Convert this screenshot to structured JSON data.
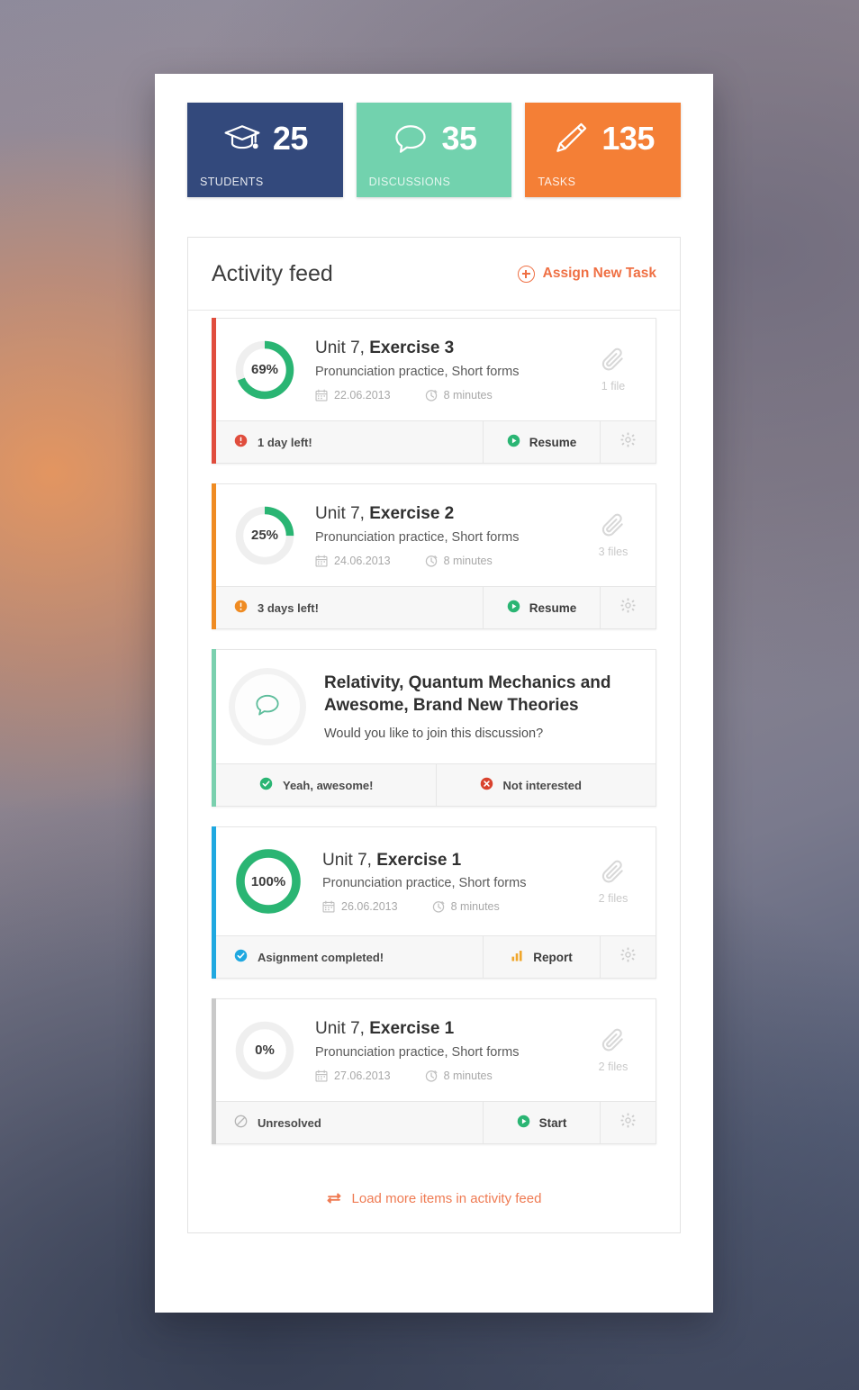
{
  "stats": [
    {
      "icon": "graduation-cap-icon",
      "value": "25",
      "label": "STUDENTS",
      "color": "#33497c"
    },
    {
      "icon": "speech-bubble-icon",
      "value": "35",
      "label": "DISCUSSIONS",
      "color": "#72d2ae"
    },
    {
      "icon": "pencil-icon",
      "value": "135",
      "label": "TASKS",
      "color": "#f47f36"
    }
  ],
  "feed": {
    "title": "Activity feed",
    "assign_label": "Assign New Task",
    "load_more_label": "Load more items in activity feed"
  },
  "cards": [
    {
      "type": "task",
      "accent": "#e04d3d",
      "progress": 69,
      "progress_label": "69%",
      "ring_color": "#2ab573",
      "ring_size": "small",
      "title_prefix": "Unit 7, ",
      "title_strong": "Exercise 3",
      "subtitle": "Pronunciation practice, Short forms",
      "date": "22.06.2013",
      "duration": "8 minutes",
      "files": "1 file",
      "status": "1 day left!",
      "status_icon": "alert-circle-icon",
      "status_color": "#e04d3d",
      "action": "Resume",
      "action_icon": "play-circle-icon",
      "action_color": "#2ab573"
    },
    {
      "type": "task",
      "accent": "#ef8b22",
      "progress": 25,
      "progress_label": "25%",
      "ring_color": "#2ab573",
      "ring_size": "small",
      "title_prefix": "Unit 7, ",
      "title_strong": "Exercise 2",
      "subtitle": "Pronunciation practice, Short forms",
      "date": "24.06.2013",
      "duration": "8 minutes",
      "files": "3 files",
      "status": "3 days left!",
      "status_icon": "alert-circle-icon",
      "status_color": "#ef8b22",
      "action": "Resume",
      "action_icon": "play-circle-icon",
      "action_color": "#2ab573"
    },
    {
      "type": "discussion",
      "accent": "#7ad0ae",
      "icon": "speech-bubble-icon",
      "icon_color": "#5dbd9b",
      "title": "Relativity, Quantum Mechanics and Awesome, Brand New Theories",
      "subtitle": "Would you like to join this discussion?",
      "choice_yes": "Yeah, awesome!",
      "choice_yes_icon": "check-circle-icon",
      "choice_yes_color": "#2ab573",
      "choice_no": "Not interested",
      "choice_no_icon": "x-circle-icon",
      "choice_no_color": "#d9422e"
    },
    {
      "type": "task",
      "accent": "#1fa8e0",
      "progress": 100,
      "progress_label": "100%",
      "ring_color": "#2ab573",
      "ring_size": "large",
      "title_prefix": "Unit 7, ",
      "title_strong": "Exercise 1",
      "subtitle": "Pronunciation practice, Short forms",
      "date": "26.06.2013",
      "duration": "8 minutes",
      "files": "2 files",
      "status": "Asignment completed!",
      "status_icon": "check-circle-icon",
      "status_color": "#1fa8e0",
      "action": "Report",
      "action_icon": "bar-chart-icon",
      "action_color": "#f0a62a"
    },
    {
      "type": "task",
      "accent": "#c9c9c9",
      "progress": 0,
      "progress_label": "0%",
      "ring_color": "#2ab573",
      "ring_size": "small",
      "title_prefix": "Unit 7, ",
      "title_strong": "Exercise 1",
      "subtitle": "Pronunciation practice, Short forms",
      "date": "27.06.2013",
      "duration": "8 minutes",
      "files": "2 files",
      "status": "Unresolved",
      "status_icon": "ban-circle-icon",
      "status_color": "#b5b5b5",
      "action": "Start",
      "action_icon": "play-circle-icon",
      "action_color": "#2ab573"
    }
  ]
}
